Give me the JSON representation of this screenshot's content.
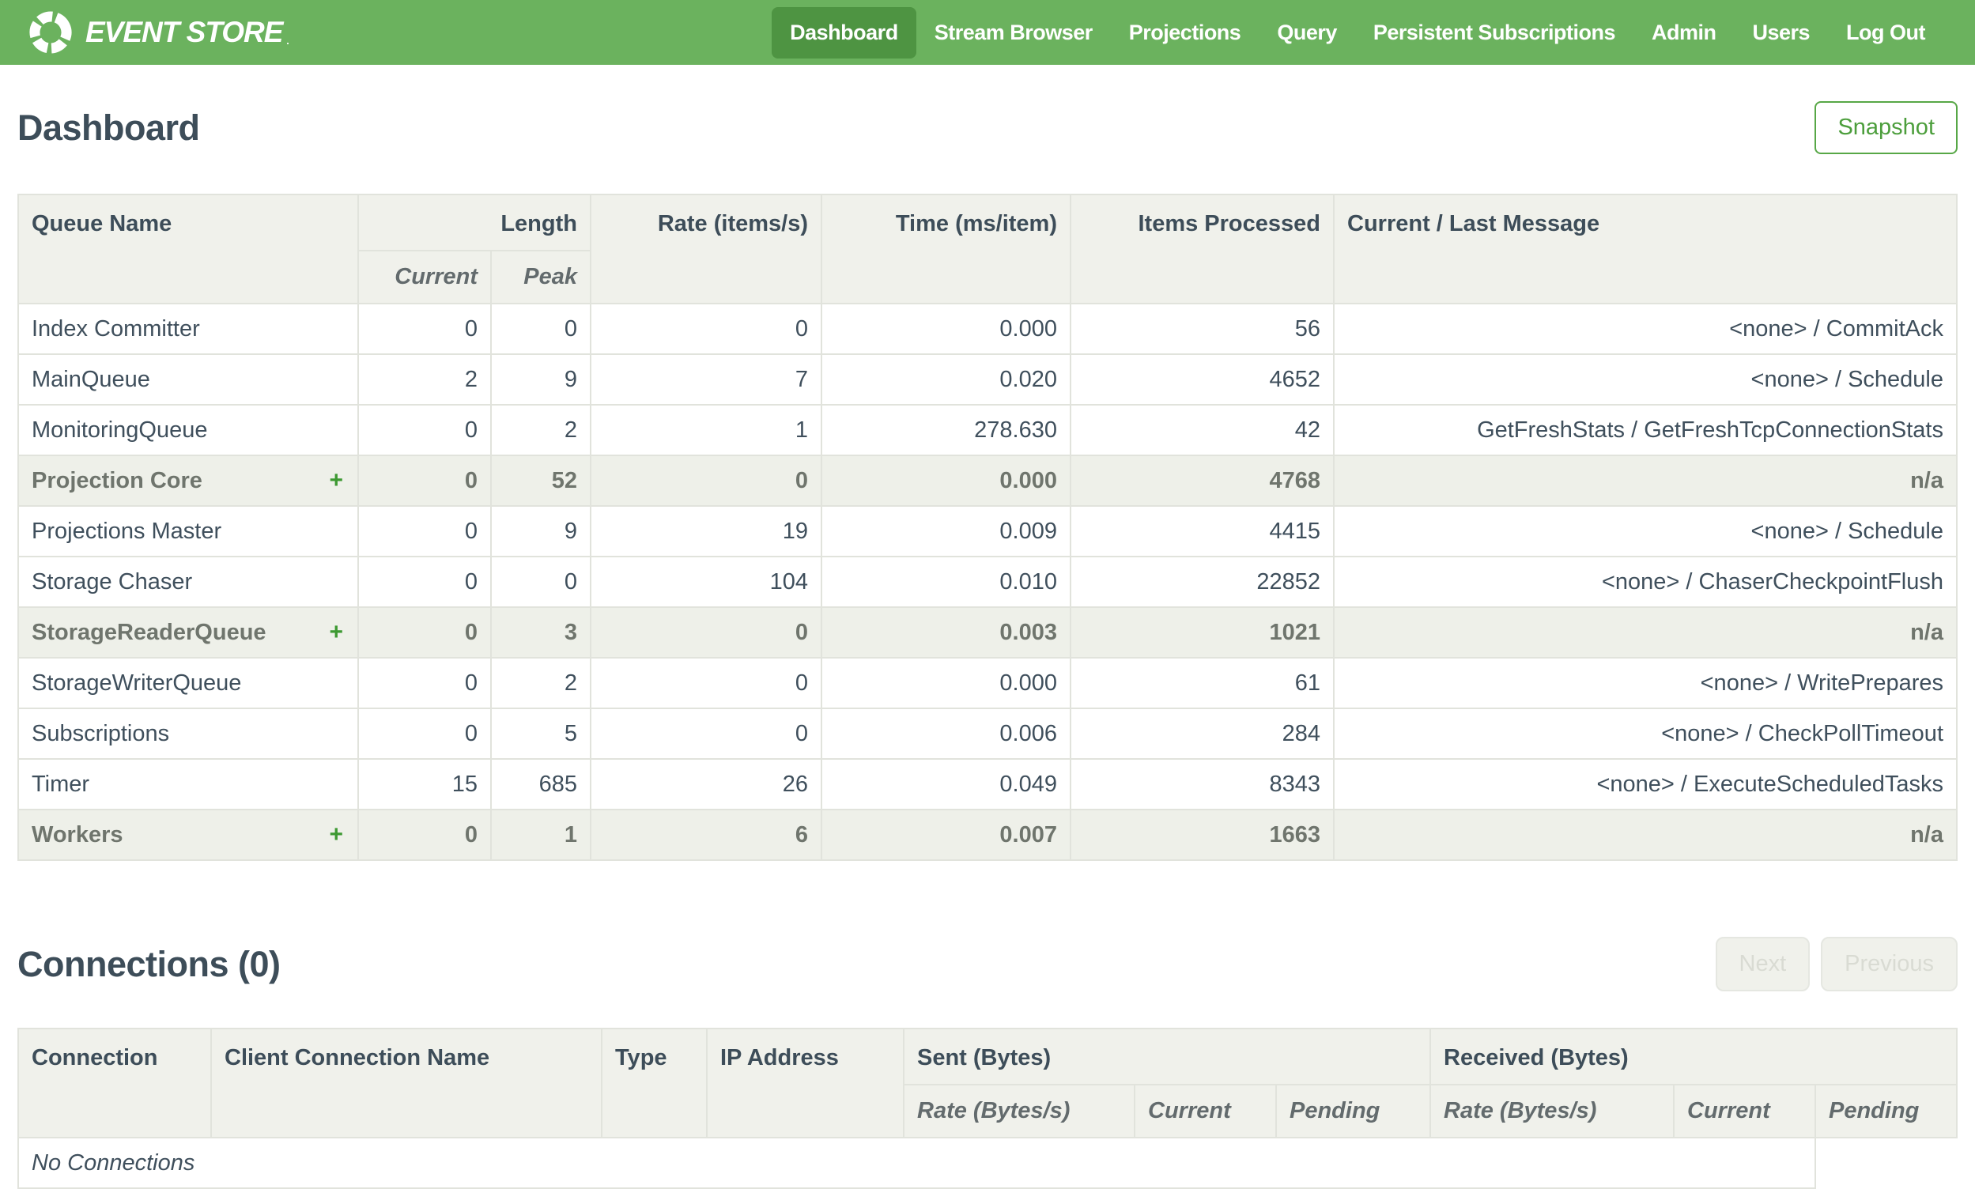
{
  "nav": {
    "brand": "EVENT STORE",
    "brand_mark": ".",
    "items": [
      {
        "label": "Dashboard",
        "active": true
      },
      {
        "label": "Stream Browser"
      },
      {
        "label": "Projections"
      },
      {
        "label": "Query"
      },
      {
        "label": "Persistent Subscriptions"
      },
      {
        "label": "Admin"
      },
      {
        "label": "Users"
      },
      {
        "label": "Log Out"
      }
    ]
  },
  "page": {
    "title": "Dashboard",
    "snapshot_button": "Snapshot"
  },
  "queues_table": {
    "headers": {
      "queue_name": "Queue Name",
      "length": "Length",
      "current": "Current",
      "peak": "Peak",
      "rate": "Rate (items/s)",
      "time": "Time (ms/item)",
      "items_processed": "Items Processed",
      "message": "Current / Last Message"
    },
    "rows": [
      {
        "name": "Index Committer",
        "current": "0",
        "peak": "0",
        "rate": "0",
        "time": "0.000",
        "items": "56",
        "message": "<none> / CommitAck"
      },
      {
        "name": "MainQueue",
        "current": "2",
        "peak": "9",
        "rate": "7",
        "time": "0.020",
        "items": "4652",
        "message": "<none> / Schedule"
      },
      {
        "name": "MonitoringQueue",
        "current": "0",
        "peak": "2",
        "rate": "1",
        "time": "278.630",
        "items": "42",
        "message": "GetFreshStats / GetFreshTcpConnectionStats"
      },
      {
        "name": "Projection Core",
        "expand": "+",
        "current": "0",
        "peak": "52",
        "rate": "0",
        "time": "0.000",
        "items": "4768",
        "message": "n/a"
      },
      {
        "name": "Projections Master",
        "current": "0",
        "peak": "9",
        "rate": "19",
        "time": "0.009",
        "items": "4415",
        "message": "<none> / Schedule"
      },
      {
        "name": "Storage Chaser",
        "current": "0",
        "peak": "0",
        "rate": "104",
        "time": "0.010",
        "items": "22852",
        "message": "<none> / ChaserCheckpointFlush"
      },
      {
        "name": "StorageReaderQueue",
        "expand": "+",
        "current": "0",
        "peak": "3",
        "rate": "0",
        "time": "0.003",
        "items": "1021",
        "message": "n/a"
      },
      {
        "name": "StorageWriterQueue",
        "current": "0",
        "peak": "2",
        "rate": "0",
        "time": "0.000",
        "items": "61",
        "message": "<none> / WritePrepares"
      },
      {
        "name": "Subscriptions",
        "current": "0",
        "peak": "5",
        "rate": "0",
        "time": "0.006",
        "items": "284",
        "message": "<none> / CheckPollTimeout"
      },
      {
        "name": "Timer",
        "current": "15",
        "peak": "685",
        "rate": "26",
        "time": "0.049",
        "items": "8343",
        "message": "<none> / ExecuteScheduledTasks"
      },
      {
        "name": "Workers",
        "expand": "+",
        "current": "0",
        "peak": "1",
        "rate": "6",
        "time": "0.007",
        "items": "1663",
        "message": "n/a"
      }
    ]
  },
  "connections": {
    "title": "Connections (0)",
    "next_button": "Next",
    "previous_button": "Previous",
    "headers": {
      "connection": "Connection",
      "client_connection_name": "Client Connection Name",
      "type": "Type",
      "ip_address": "IP Address",
      "sent": "Sent (Bytes)",
      "received": "Received (Bytes)",
      "rate": "Rate (Bytes/s)",
      "current": "Current",
      "pending": "Pending"
    },
    "empty_message": "No Connections"
  },
  "colors": {
    "nav_green": "#6bb25e",
    "nav_active_green": "#4e9442",
    "accent_green": "#4c9e3c",
    "plus_green": "#3d9932",
    "heading_text": "#3d4d59",
    "body_text": "#3f4f5c",
    "table_header_bg": "#f0f1eb",
    "group_row_bg": "#eef0e9",
    "border": "#e1e3dc",
    "disabled_text": "#d9dbd3"
  }
}
